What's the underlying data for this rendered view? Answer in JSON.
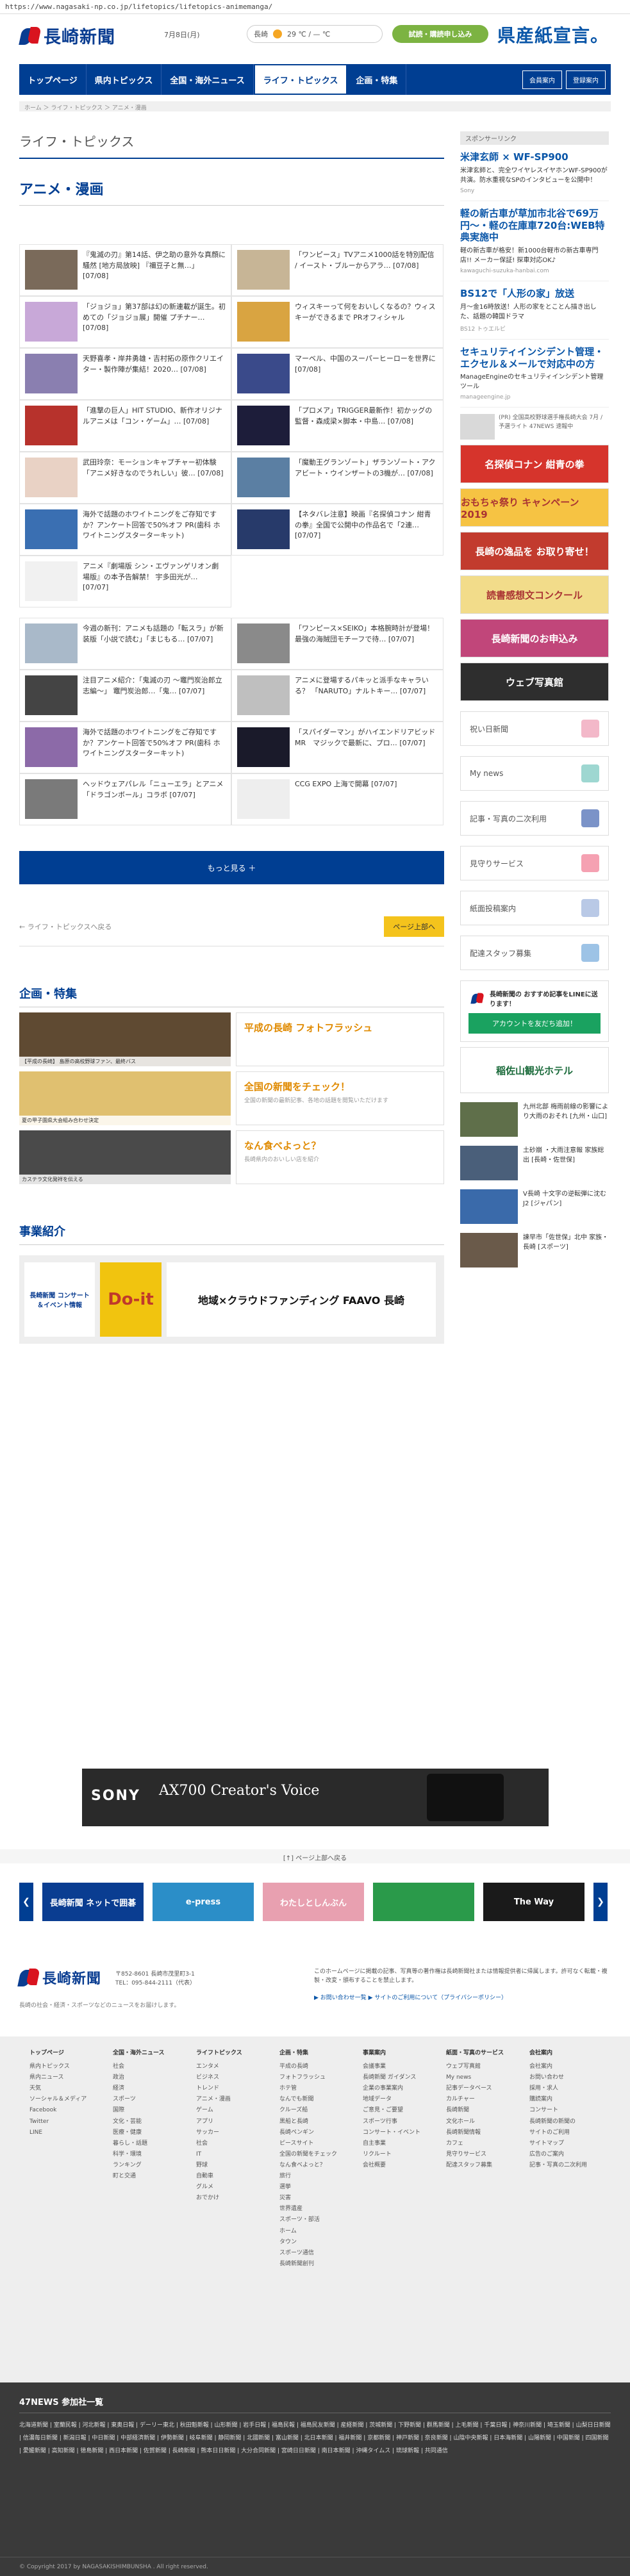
{
  "url": "https://www.nagasaki-np.co.jp/lifetopics/lifetopics-animemanga/",
  "header": {
    "logo_text": "長崎新聞",
    "date": "7月8日(月)",
    "weather_label": "長崎",
    "weather_temp": "29 ℃ / — ℃",
    "trial_button": "試読・購読申し込み",
    "ad_banner": "県産紙宣言。"
  },
  "nav": {
    "items": [
      "トップページ",
      "県内トピックス",
      "全国・海外ニュース",
      "ライフ・トピックス",
      "企画・特集"
    ],
    "active_index": 3,
    "login": "会員案内",
    "subscribe": "登録案内"
  },
  "breadcrumb": "ホーム ＞ ライフ・トピックス ＞ アニメ・漫画",
  "page": {
    "section": "ライフ・トピックス",
    "category": "アニメ・漫画"
  },
  "articles": [
    {
      "title": "『鬼滅の刃』第14話、伊之助の意外な真顔に騒然 [地方局放映] 『禰豆子と無…」",
      "date": "[07/08]",
      "color": "#7a6a5a"
    },
    {
      "title": "「ワンピース」TVアニメ1000話を特別配信 / イースト・ブルーからアラ…",
      "date": "[07/08]",
      "color": "#c7b596"
    },
    {
      "title": "「ジョジョ」第37部は幻の新連載が誕生。初めての「ジョジョ展」開催 プチナー…",
      "date": "[07/08]",
      "color": "#c8a8d8"
    },
    {
      "title": "ウィスキーって何をおいしくなるの？ウィスキーができるまで",
      "date": "PRオフィシャル",
      "color": "#d9a441"
    },
    {
      "title": "天野喜孝・岸井勇雄・吉村拓の原作クリエイター・製作陣が集結！2020…",
      "date": "[07/08]",
      "color": "#8a7fb0"
    },
    {
      "title": "マーベル、中国のスーパーヒーローを世界に",
      "date": "[07/08]",
      "color": "#3a4a8a"
    },
    {
      "title": "「進撃の巨人」HIT STUDIO、新作オリジナルアニメは「コン・ゲーム」…",
      "date": "[07/08]",
      "color": "#b7322c"
    },
    {
      "title": "「プロメア」TRIGGER最新作！初かッグの監督・森成梁×脚本・中島…",
      "date": "[07/08]",
      "color": "#1d1d3a"
    },
    {
      "title": "武田玲奈：モーションキャプチャー初体験「アニメ好きなのでうれしい」彼…",
      "date": "[07/08]",
      "color": "#e9d2c5"
    },
    {
      "title": "「魔動王グランゾート」ザランゾート・アクアビート・ウインザートの3機が…",
      "date": "[07/08]",
      "color": "#5b7fa3"
    },
    {
      "title": "海外で話題のホワイトニングをご存知ですか？アンケート回答で50%オフ",
      "date": "PR(歯科 ホワイトニングスターターキット)",
      "color": "#3a6fb2"
    },
    {
      "title": "【ネタバレ注意】映画『名探偵コナン 紺青の拳』全国で公開中の作品名で「2連…",
      "date": "[07/07]",
      "color": "#273a6a"
    },
    {
      "title": "アニメ『劇場版 シン・エヴァンゲリオン劇場版』の本予告解禁！ 宇多田光が…",
      "date": "[07/07]",
      "color": "#f1f1f1"
    },
    {
      "title": "",
      "date": "",
      "color": "#ffffff"
    },
    {
      "title": "今週の新刊：アニメも話題の「転スラ」が新装版「小説で読む」「まじもる…",
      "date": "[07/07]",
      "color": "#a9b9c9"
    },
    {
      "title": "「ワンピース×SEIKO」本格腕時計が登場！最強の海賊団モチーフで待…",
      "date": "[07/07]",
      "color": "#8a8a8a"
    },
    {
      "title": "注目アニメ紹介：「鬼滅の刃 ～竈門炭治郎立志編～」 竈門炭治郎…「鬼…",
      "date": "[07/07]",
      "color": "#444444"
    },
    {
      "title": "アニメに登場するパキッと派手なキャラいる？ 「NARUTO」ナルトキー…",
      "date": "[07/07]",
      "color": "#bfbfbf"
    },
    {
      "title": "海外で話題のホワイトニングをご存知ですか？アンケート回答で50%オフ",
      "date": "PR(歯科 ホワイトニングスターターキット)",
      "color": "#8c6aa8"
    },
    {
      "title": "「スパイダーマン」がハイエンドリアビッドMR　マジックで最新に、プロ…",
      "date": "[07/07]",
      "color": "#1a1a2a"
    },
    {
      "title": "ヘッドウェアパレル「ニューエラ」とアニメ「ドラゴンボール」コラボ",
      "date": "[07/07]",
      "color": "#7a7a7a"
    },
    {
      "title": "CCG EXPO 上海で開幕",
      "date": "[07/07]",
      "color": "#eeeeee"
    }
  ],
  "more_button": "もっと見る ＋",
  "pager": {
    "back": "← ライフ・トピックスへ戻る",
    "top": "ページ上部へ"
  },
  "features": {
    "title": "企画・特集",
    "rows": [
      {
        "name": "平成の長崎 フォトフラッシュ",
        "desc": "",
        "img_color": "#5f4a32",
        "img_caption": "【平成の長崎】 島原の高校野球ファン、最終バス"
      },
      {
        "name": "全国の新聞をチェック！",
        "desc": "全国の新聞の最新記事、各地の話題を閲覧いただけます",
        "img_color": "#e0c070",
        "img_caption": "夏の甲子園県大会組み合わせ決定"
      },
      {
        "name": "なん食べよっと？",
        "desc": "長崎県内のおいしい店を紹介",
        "img_color": "#4a4a4a",
        "img_caption": "カステラ文化発祥を伝える"
      }
    ]
  },
  "business": {
    "title": "事業紹介",
    "banners": [
      "長崎新聞 コンサート＆イベント情報",
      "Do-it",
      "地域×クラウドファンディング FAAVO 長崎"
    ]
  },
  "sidebar": {
    "sponsor_label": "スポンサーリンク",
    "ads": [
      {
        "title": "米津玄師 × WF-SP900",
        "desc": "米津玄師と、完全ワイヤレスイヤホンWF-SP900が共演。防水重視なSPのインタビューを公開中！",
        "source": "Sony"
      },
      {
        "title": "軽の新古車が草加市北谷で69万円〜・軽の在庫車720台:WEB特典実施中",
        "desc": "軽の新古車が格安！新1000台軽市の新古車専門店!! メーカー保証! 探車対応OK♪",
        "source": "kawaguchi-suzuka-hanbai.com"
      },
      {
        "title": "BS12で「人形の家」放送",
        "desc": "月〜金16時放送！人形の家をとことん描き出した、話題の韓国ドラマ",
        "source": "BS12 トゥエルビ"
      },
      {
        "title": "セキュリティインシデント管理・エクセル＆メールで対応中の方",
        "desc": "ManageEngineのセキュリティインシデント管理ツール",
        "source": "manageengine.jp"
      }
    ],
    "notice": "(PR) 全国高校野球選手権長崎大会 7月 / 予選ライト 47NEWS 速報中",
    "banners": [
      {
        "label": "名探偵コナン 紺青の拳",
        "color": "#d6342c"
      },
      {
        "label": "おもちゃ祭り キャンペーン 2019",
        "color": "#f6c343"
      },
      {
        "label": "長崎の逸品を お取り寄せ！",
        "color": "#c23b2e"
      },
      {
        "label": "読書感想文コンクール",
        "color": "#f2dc8a"
      },
      {
        "label": "長崎新聞のお申込み",
        "color": "#c1467a"
      },
      {
        "label": "ウェブ写真館",
        "color": "#2e2e2e"
      }
    ],
    "link_boxes": [
      {
        "label": "祝い日新聞",
        "icon_color": "#f3b8c9"
      },
      {
        "label": "My news",
        "icon_color": "#9ed7d1"
      },
      {
        "label": "記事・写真の二次利用",
        "icon_color": "#7b93c8"
      },
      {
        "label": "見守りサービス",
        "icon_color": "#f5a1b2"
      },
      {
        "label": "紙面投稿案内",
        "icon_color": "#b9c9e6"
      },
      {
        "label": "配達スタッフ募集",
        "icon_color": "#9dc3e6"
      }
    ],
    "line": {
      "title": "長崎新聞の おすすめ記事をLINEに送ります！",
      "button": "アカウントを友だち追加！"
    },
    "hotel": "稲佐山観光ホテル",
    "small_news": [
      {
        "text": "九州北部 梅雨前線の影響により大雨のおそれ [九州・山口]",
        "color": "#5f6f4a"
      },
      {
        "text": "土砂崩 ・大雨注意報 家族総出 [長崎・佐世保]",
        "color": "#4a5f7a"
      },
      {
        "text": "V長崎 十文字の逆転弾に沈む J2 [ジャパン]",
        "color": "#3a6aaa"
      },
      {
        "text": "諫早市「佐世保」北中 家族・長崎 [スポーツ]",
        "color": "#6a5a4a"
      }
    ]
  },
  "sony_ad": {
    "brand": "SONY",
    "tagline": "AX700 Creator's Voice"
  },
  "pagetop_strip": "[↑] ページ上部へ戻る",
  "carousel": [
    {
      "label": "長崎新聞 ネットで囲碁",
      "color": "#0a3d91"
    },
    {
      "label": "e-press",
      "color": "#2b8ec8"
    },
    {
      "label": "わたしとしんぶん",
      "color": "#e8a0b0"
    },
    {
      "label": "",
      "color": "#2a9a4a"
    },
    {
      "label": "The Way",
      "color": "#1a1a1a"
    }
  ],
  "footer": {
    "address": "〒852-8601 長崎市茂里町3-1",
    "tel": "TEL：095-844-2111（代表）",
    "note": "長崎の社会・経済・スポーツなどのニュースをお届けします。",
    "disclaimer": "このホームページに掲載の記事、写真等の著作権は長崎新聞社または情報提供者に帰属します。許可なく転載・複製・改変・頒布することを禁止します。",
    "policy_links": "▶ お問い合わせ一覧   ▶ サイトのご利用について（プライバシーポリシー）"
  },
  "footer_columns": [
    {
      "head": "トップページ",
      "items": [
        "県内トピックス",
        "県内ニュース",
        "天気",
        "ソーシャル＆メディア",
        "Facebook",
        "Twitter",
        "LINE"
      ]
    },
    {
      "head": "全国・海外ニュース",
      "items": [
        "社会",
        "政治",
        "経済",
        "スポーツ",
        "国際",
        "文化・芸能",
        "医療・健康",
        "暮らし・話題",
        "科学・環境",
        "ランキング",
        "町と交通"
      ]
    },
    {
      "head": "ライフトピックス",
      "items": [
        "エンタメ",
        "ビジネス",
        "トレンド",
        "アニメ・漫画",
        "ゲーム",
        "アプリ",
        "サッカー",
        "社会",
        "IT",
        "野球",
        "自動車",
        "グルメ",
        "おでかけ"
      ]
    },
    {
      "head": "企画・特集",
      "items": [
        "平成の長崎",
        "フォトフラッシュ",
        "ホテ管",
        "なんでも新聞",
        "クルーズ船",
        "黒船と長崎",
        "長崎ペンギン",
        "ピースサイト",
        "全国の新聞をチェック",
        "なん食べよっと？",
        "旅行",
        "選挙",
        "災害",
        "世界遺産",
        "スポーツ・部活",
        "ホーム",
        "タウン",
        "スポーツ通信",
        "長崎新聞創刊"
      ]
    },
    {
      "head": "事業案内",
      "items": [
        "会議事業",
        "長崎新聞 ガイダンス",
        "企業の事業案内",
        "地域データ",
        "ご意見・ご要望",
        "スポーツ行事",
        "コンサート・イベント",
        "自主事業",
        "リクルート",
        "会社概要"
      ]
    },
    {
      "head": "紙面・写真のサービス",
      "items": [
        "ウェブ写真館",
        "My news",
        "記事データベース",
        "カルチャー",
        "長崎新聞",
        "文化ホール",
        "長崎新聞情報",
        "カフェ",
        "見守りサービス",
        "配達スタッフ募集"
      ]
    },
    {
      "head": "会社案内",
      "items": [
        "会社案内",
        "お問い合わせ",
        "採用・求人",
        "購読案内",
        "コンサート",
        "長崎新聞の新聞の",
        "サイトのご利用",
        "サイトマップ",
        "広告のご案内",
        "記事・写真の二次利用"
      ]
    }
  ],
  "news47": {
    "title": "47NEWS 参加社一覧",
    "list": "北海道新聞 | 室蘭民報 | 河北新報 | 東奥日報 | デーリー東北 | 秋田魁新報 | 山形新聞 | 岩手日報 | 福島民報 | 福島民友新聞 | 産経新聞 | 茨城新聞 | 下野新聞 | 群馬新聞 | 上毛新聞 | 千葉日報 | 神奈川新聞 | 埼玉新聞 | 山梨日日新聞 | 信濃毎日新聞 | 新潟日報 | 中日新聞 | 中部経済新聞 | 伊勢新聞 | 岐阜新聞 | 静岡新聞 | 北國新聞 | 富山新聞 | 北日本新聞 | 福井新聞 | 京都新聞 | 神戸新聞 | 奈良新聞 | 山陰中央新報 | 日本海新聞 | 山陽新聞 | 中国新聞 | 四国新聞 | 愛媛新聞 | 高知新聞 | 徳島新聞 | 西日本新聞 | 佐賀新聞 | 長崎新聞 | 熊本日日新聞 | 大分合同新聞 | 宮崎日日新聞 | 南日本新聞 | 沖縄タイムス | 琉球新報 | 共同通信"
  },
  "copyright": "© Copyright 2017 by NAGASAKISHIMBUNSHA . All right reserved."
}
